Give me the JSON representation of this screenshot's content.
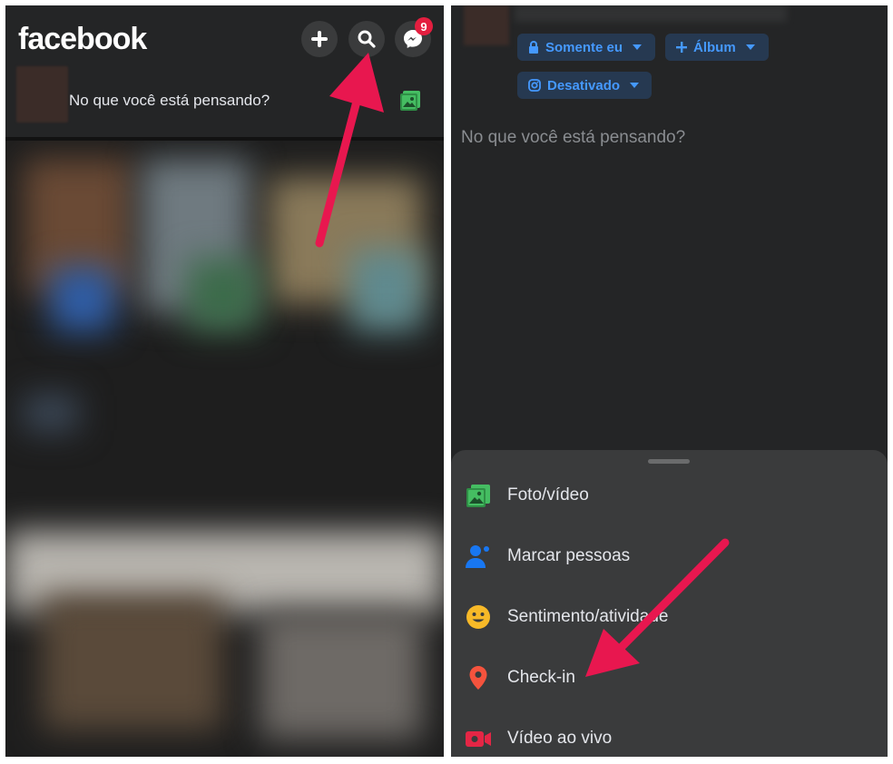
{
  "left": {
    "logo": "facebook",
    "messenger_badge": "9",
    "composer_prompt": "No que você está pensando?",
    "icons": [
      "plus-icon",
      "search-icon",
      "messenger-icon",
      "photo-icon"
    ]
  },
  "right": {
    "chips": [
      {
        "label": "Somente eu",
        "icon": "lock-icon"
      },
      {
        "label": "Álbum",
        "icon": "plus-icon"
      },
      {
        "label": "Desativado",
        "icon": "instagram-icon"
      }
    ],
    "composer_prompt": "No que você está pensando?",
    "options": [
      {
        "label": "Foto/vídeo",
        "icon": "photo-video-icon",
        "color": "#45bd62"
      },
      {
        "label": "Marcar pessoas",
        "icon": "tag-people-icon",
        "color": "#1877f2"
      },
      {
        "label": "Sentimento/atividade",
        "icon": "feeling-icon",
        "color": "#f7b928"
      },
      {
        "label": "Check-in",
        "icon": "location-pin-icon",
        "color": "#f5533d"
      },
      {
        "label": "Vídeo ao vivo",
        "icon": "live-video-icon",
        "color": "#e42645"
      }
    ]
  },
  "colors": {
    "annotation_arrow": "#e8174f",
    "chip_text": "#4599ff",
    "background_dark": "#242526"
  }
}
